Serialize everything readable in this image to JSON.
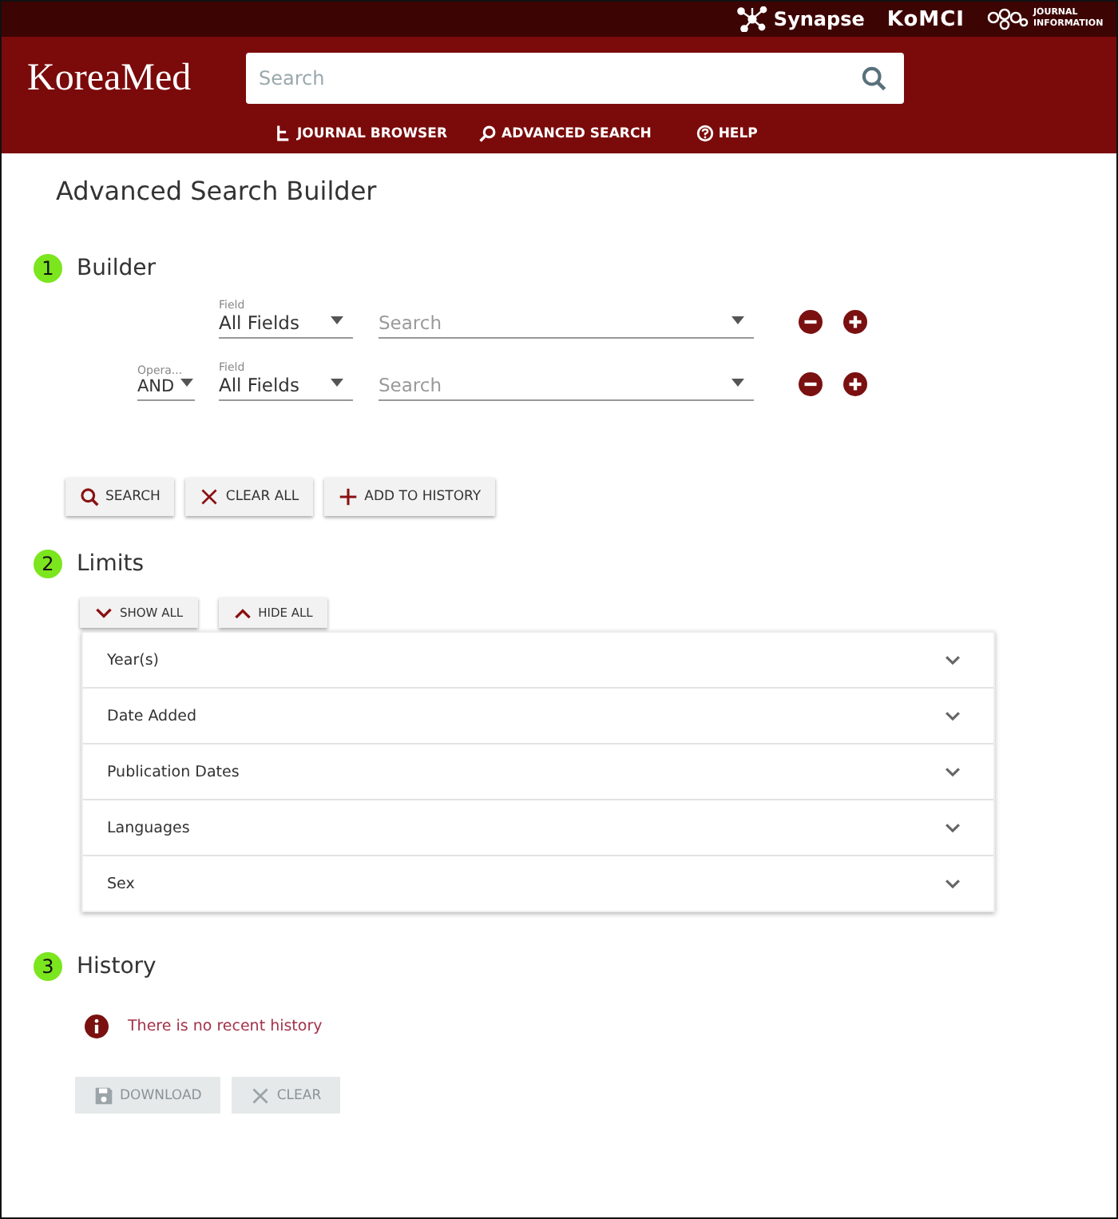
{
  "partners": [
    {
      "kind": "synapse",
      "label": "Synapse"
    },
    {
      "kind": "komci",
      "label": "KoMCI"
    },
    {
      "kind": "journal",
      "label": "JOURNAL INFORMATION"
    }
  ],
  "logo": "KoreaMed",
  "search": {
    "placeholder": "Search"
  },
  "nav": [
    {
      "kind": "browser",
      "label": "JOURNAL BROWSER"
    },
    {
      "kind": "advanced",
      "label": "ADVANCED SEARCH"
    },
    {
      "kind": "help",
      "label": "HELP"
    }
  ],
  "page_title": "Advanced Search Builder",
  "builder": {
    "number": "1",
    "title": "Builder",
    "rows": [
      {
        "field_label": "Field",
        "field": "All Fields",
        "term_placeholder": "Search"
      },
      {
        "operator_label": "Opera...",
        "operator": "AND",
        "field_label": "Field",
        "field": "All Fields",
        "term_placeholder": "Search"
      }
    ],
    "buttons": [
      {
        "kind": "search",
        "label": "SEARCH"
      },
      {
        "kind": "clear",
        "label": "CLEAR ALL"
      },
      {
        "kind": "add",
        "label": "ADD TO HISTORY"
      }
    ]
  },
  "limits": {
    "number": "2",
    "title": "Limits",
    "buttons": [
      {
        "kind": "down",
        "label": "SHOW ALL"
      },
      {
        "kind": "up",
        "label": "HIDE ALL"
      }
    ],
    "items": [
      {
        "label": "Year(s)",
        "expanded": false
      },
      {
        "label": "Date Added",
        "expanded": false
      },
      {
        "label": "Publication Dates",
        "expanded": false
      },
      {
        "label": "Languages",
        "expanded": false
      },
      {
        "label": "Sex",
        "expanded": false
      }
    ]
  },
  "history": {
    "number": "3",
    "title": "History",
    "message": "There is no recent history",
    "buttons": [
      {
        "kind": "save",
        "label": "DOWNLOAD",
        "disabled": true
      },
      {
        "kind": "clear",
        "label": "CLEAR",
        "disabled": true
      }
    ]
  }
}
